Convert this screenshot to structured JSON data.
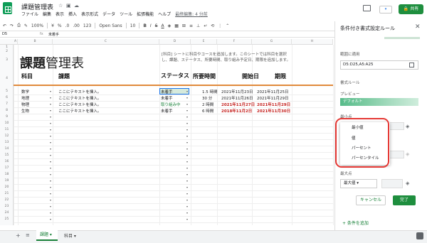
{
  "app": {
    "doc_title": "課題管理表",
    "share_label": "共有",
    "present_label": "▾"
  },
  "menu": [
    "ファイル",
    "編集",
    "表示",
    "挿入",
    "表示形式",
    "データ",
    "ツール",
    "拡張機能",
    "ヘルプ"
  ],
  "menu_last_edit": "最終編集: 4 分前",
  "toolbar": {
    "zoom": "100%",
    "currency": "¥",
    "percent": "%",
    "dec1": ".0",
    "dec2": ".00",
    "format123": "123",
    "font": "Open Sans",
    "size": "10",
    "bold": "B",
    "italic": "I",
    "strike": "S",
    "textcolor": "A"
  },
  "formula": {
    "cell": "D5",
    "fx": "fx",
    "value": "未着手"
  },
  "columns": [
    "A",
    "B",
    "C",
    "D",
    "E",
    "F",
    "G",
    "H"
  ],
  "rows": [
    "1",
    "2",
    "3",
    "4",
    "5",
    "6",
    "7",
    "8",
    "9",
    "10",
    "11",
    "12",
    "13",
    "14",
    "15",
    "16",
    "17",
    "18",
    "19",
    "20",
    "21",
    "22",
    "23",
    "24",
    "25"
  ],
  "sheet": {
    "title_bold": "課題",
    "title_rest": "管理表",
    "description": "[科目] シートに科目やコースを追加します。このシートでは科目を選択し、課題、ステータス、所要時間、取り組み予定日、期限を追加します。",
    "headers": {
      "subject": "科目",
      "task": "課題",
      "status": "ステータス",
      "time": "所要時間",
      "start": "開始日",
      "due": "期限"
    },
    "rows": [
      {
        "subject": "数学",
        "task": "ここにテキストを挿入。",
        "status": "未着手",
        "time": "1.5 時間",
        "start": "2021年11月23日",
        "due": "2021年11月25日"
      },
      {
        "subject": "地理",
        "task": "ここにテキストを挿入。",
        "status": "未着手",
        "time": "30 分",
        "start": "2021年11月26日",
        "due": "2021年11月29日"
      },
      {
        "subject": "物理",
        "task": "ここにテキストを挿入。",
        "status": "取り組み中",
        "time": "2 時間",
        "start": "2021年11月27日",
        "due": "2021年11月29日"
      },
      {
        "subject": "生物",
        "task": "ここにテキストを挿入。",
        "status": "未着手",
        "time": "6 時間",
        "start": "2018年11月2日",
        "due": "2021年11月30日"
      }
    ],
    "dropdown_arrow": "▾"
  },
  "tabs": {
    "active": "課題",
    "other": "科目"
  },
  "panel": {
    "title": "条件付き書式設定ルール",
    "range_label": "範囲に適用",
    "range_value": "D5:D25,A5:A25",
    "format_rule_label": "書式ルール",
    "preview_label": "プレビュー",
    "preview_text": "デフォルト",
    "min_label": "最小点",
    "options": [
      "最小値",
      "値",
      "パーセント",
      "パーセンタイル"
    ],
    "max_label": "最大点",
    "max_value": "最大値",
    "cancel": "キャンセル",
    "done": "完了",
    "add_rule": "+ 条件を追加"
  },
  "colors": {
    "accent": "#1e8e3e",
    "status_red": "#c5221f",
    "status_green": "#188038",
    "header_line": "#e08a3c"
  }
}
